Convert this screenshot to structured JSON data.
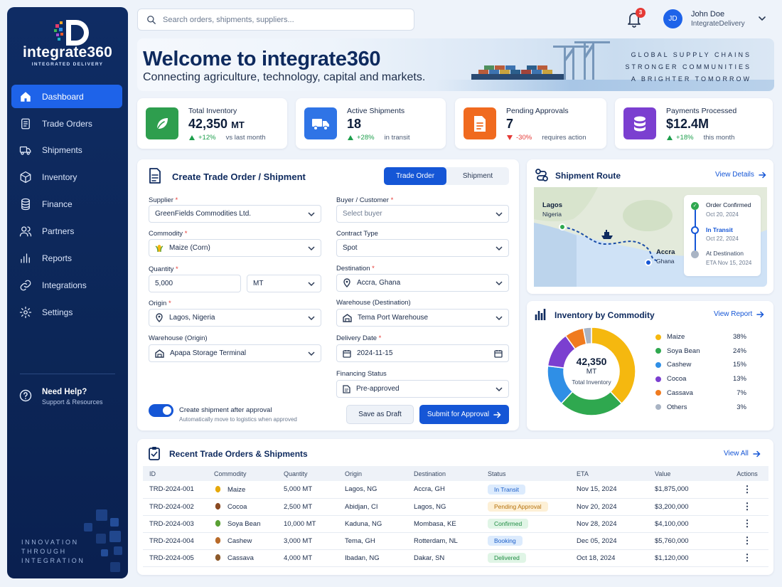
{
  "sidebar": {
    "logo_text": "integrate360",
    "logo_sub": "INTEGRATED DELIVERY",
    "nav": [
      {
        "label": "Dashboard",
        "icon": "home-icon"
      },
      {
        "label": "Trade Orders",
        "icon": "document-icon"
      },
      {
        "label": "Shipments",
        "icon": "truck-icon"
      },
      {
        "label": "Inventory",
        "icon": "box-icon"
      },
      {
        "label": "Finance",
        "icon": "coins-icon"
      },
      {
        "label": "Partners",
        "icon": "users-icon"
      },
      {
        "label": "Reports",
        "icon": "bar-chart-icon"
      },
      {
        "label": "Integrations",
        "icon": "link-icon"
      },
      {
        "label": "Settings",
        "icon": "gear-icon"
      }
    ],
    "help_title": "Need Help?",
    "help_sub": "Support & Resources",
    "tagline": [
      "INNOVATION",
      "THROUGH",
      "INTEGRATION"
    ]
  },
  "header": {
    "search_placeholder": "Search orders, shipments, suppliers...",
    "notifications": "3",
    "avatar": "JD",
    "user_name": "John Doe",
    "user_org": "IntegrateDelivery"
  },
  "banner": {
    "title": "Welcome to integrate360",
    "subtitle": "Connecting agriculture, technology, capital and markets.",
    "tag1": "GLOBAL SUPPLY CHAINS",
    "tag2": "STRONGER COMMUNITIES",
    "tag3": "A BRIGHTER TOMORROW"
  },
  "kpis": [
    {
      "label": "Total Inventory",
      "value": "42,350",
      "unit": "MT",
      "change": "+12%",
      "note": "vs last month",
      "dir": "up",
      "color": "#2e9e4e",
      "icon": "leaf-icon"
    },
    {
      "label": "Active Shipments",
      "value": "18",
      "unit": "",
      "change": "+28%",
      "note": "in transit",
      "dir": "up",
      "color": "#2f74e6",
      "icon": "truck-icon"
    },
    {
      "label": "Pending Approvals",
      "value": "7",
      "unit": "",
      "change": "-30%",
      "note": "requires action",
      "dir": "down",
      "color": "#f06a1f",
      "icon": "document-icon"
    },
    {
      "label": "Payments Processed",
      "value": "$12.4M",
      "unit": "",
      "change": "+18%",
      "note": "this month",
      "dir": "up",
      "color": "#7b3fd0",
      "icon": "coins-icon"
    }
  ],
  "form": {
    "title": "Create Trade Order / Shipment",
    "tab_order": "Trade Order",
    "tab_shipment": "Shipment",
    "supplier_label": "Supplier",
    "supplier_value": "GreenFields Commodities Ltd.",
    "commodity_label": "Commodity",
    "commodity_value": "Maize (Corn)",
    "quantity_label": "Quantity",
    "quantity_value": "5,000",
    "unit_value": "MT",
    "origin_label": "Origin",
    "origin_value": "Lagos, Nigeria",
    "wh_origin_label": "Warehouse (Origin)",
    "wh_origin_value": "Apapa Storage Terminal",
    "buyer_label": "Buyer / Customer",
    "buyer_placeholder": "Select buyer",
    "contract_label": "Contract Type",
    "contract_value": "Spot",
    "dest_label": "Destination",
    "dest_value": "Accra, Ghana",
    "wh_dest_label": "Warehouse (Destination)",
    "wh_dest_value": "Tema Port Warehouse",
    "date_label": "Delivery Date",
    "date_value": "2024-11-15",
    "fin_label": "Financing Status",
    "fin_value": "Pre-approved",
    "toggle_label": "Create shipment after approval",
    "toggle_sub": "Automatically move to logistics when approved",
    "draft_label": "Save as Draft",
    "submit_label": "Submit for Approval"
  },
  "route": {
    "title": "Shipment Route",
    "link": "View Details",
    "from_city": "Lagos",
    "from_country": "Nigeria",
    "to_city": "Accra",
    "to_country": "Ghana",
    "steps": [
      {
        "label": "Order Confirmed",
        "date": "Oct 20, 2024"
      },
      {
        "label": "In Transit",
        "date": "Oct 22, 2024"
      },
      {
        "label": "At Destination",
        "date": "ETA Nov 15, 2024"
      }
    ]
  },
  "inventory": {
    "title": "Inventory by Commodity",
    "link": "View Report",
    "total": "42,350",
    "unit": "MT",
    "total_label": "Total Inventory"
  },
  "chart_data": {
    "type": "pie",
    "categories": [
      "Maize",
      "Soya Bean",
      "Cashew",
      "Cocoa",
      "Cassava",
      "Others"
    ],
    "values": [
      38,
      24,
      15,
      13,
      7,
      3
    ],
    "colors": [
      "#f5b80f",
      "#2fa84f",
      "#2f8fe6",
      "#7b3fd0",
      "#f07b1f",
      "#a9b4c4"
    ],
    "labels": [
      "38%",
      "24%",
      "15%",
      "13%",
      "7%",
      "3%"
    ]
  },
  "recent": {
    "title": "Recent Trade Orders & Shipments",
    "link": "View All",
    "columns": [
      "ID",
      "Commodity",
      "Quantity",
      "Origin",
      "Destination",
      "Status",
      "ETA",
      "Value",
      "Actions"
    ],
    "rows": [
      {
        "id": "TRD-2024-001",
        "commodity": "Maize",
        "qty": "5,000 MT",
        "origin": "Lagos, NG",
        "dest": "Accra, GH",
        "status": "In Transit",
        "eta": "Nov 15, 2024",
        "value": "$1,875,000",
        "icolor": "#e6a90c",
        "sbg": "#dcebfd",
        "sfg": "#1d5fc9"
      },
      {
        "id": "TRD-2024-002",
        "commodity": "Cocoa",
        "qty": "2,500 MT",
        "origin": "Abidjan, CI",
        "dest": "Lagos, NG",
        "status": "Pending Approval",
        "eta": "Nov 20, 2024",
        "value": "$3,200,000",
        "icolor": "#8a4a22",
        "sbg": "#fdf0d6",
        "sfg": "#b5700a"
      },
      {
        "id": "TRD-2024-003",
        "commodity": "Soya Bean",
        "qty": "10,000 MT",
        "origin": "Kaduna, NG",
        "dest": "Mombasa, KE",
        "status": "Confirmed",
        "eta": "Nov 28, 2024",
        "value": "$4,100,000",
        "icolor": "#5aa034",
        "sbg": "#e0f5e6",
        "sfg": "#1f8c43"
      },
      {
        "id": "TRD-2024-004",
        "commodity": "Cashew",
        "qty": "3,000 MT",
        "origin": "Tema, GH",
        "dest": "Rotterdam, NL",
        "status": "Booking",
        "eta": "Dec 05, 2024",
        "value": "$5,760,000",
        "icolor": "#b96b2a",
        "sbg": "#dcebfd",
        "sfg": "#1d5fc9"
      },
      {
        "id": "TRD-2024-005",
        "commodity": "Cassava",
        "qty": "4,000 MT",
        "origin": "Ibadan, NG",
        "dest": "Dakar, SN",
        "status": "Delivered",
        "eta": "Oct 18, 2024",
        "value": "$1,120,000",
        "icolor": "#8d5a2b",
        "sbg": "#e0f5e6",
        "sfg": "#1f8c43"
      }
    ]
  }
}
